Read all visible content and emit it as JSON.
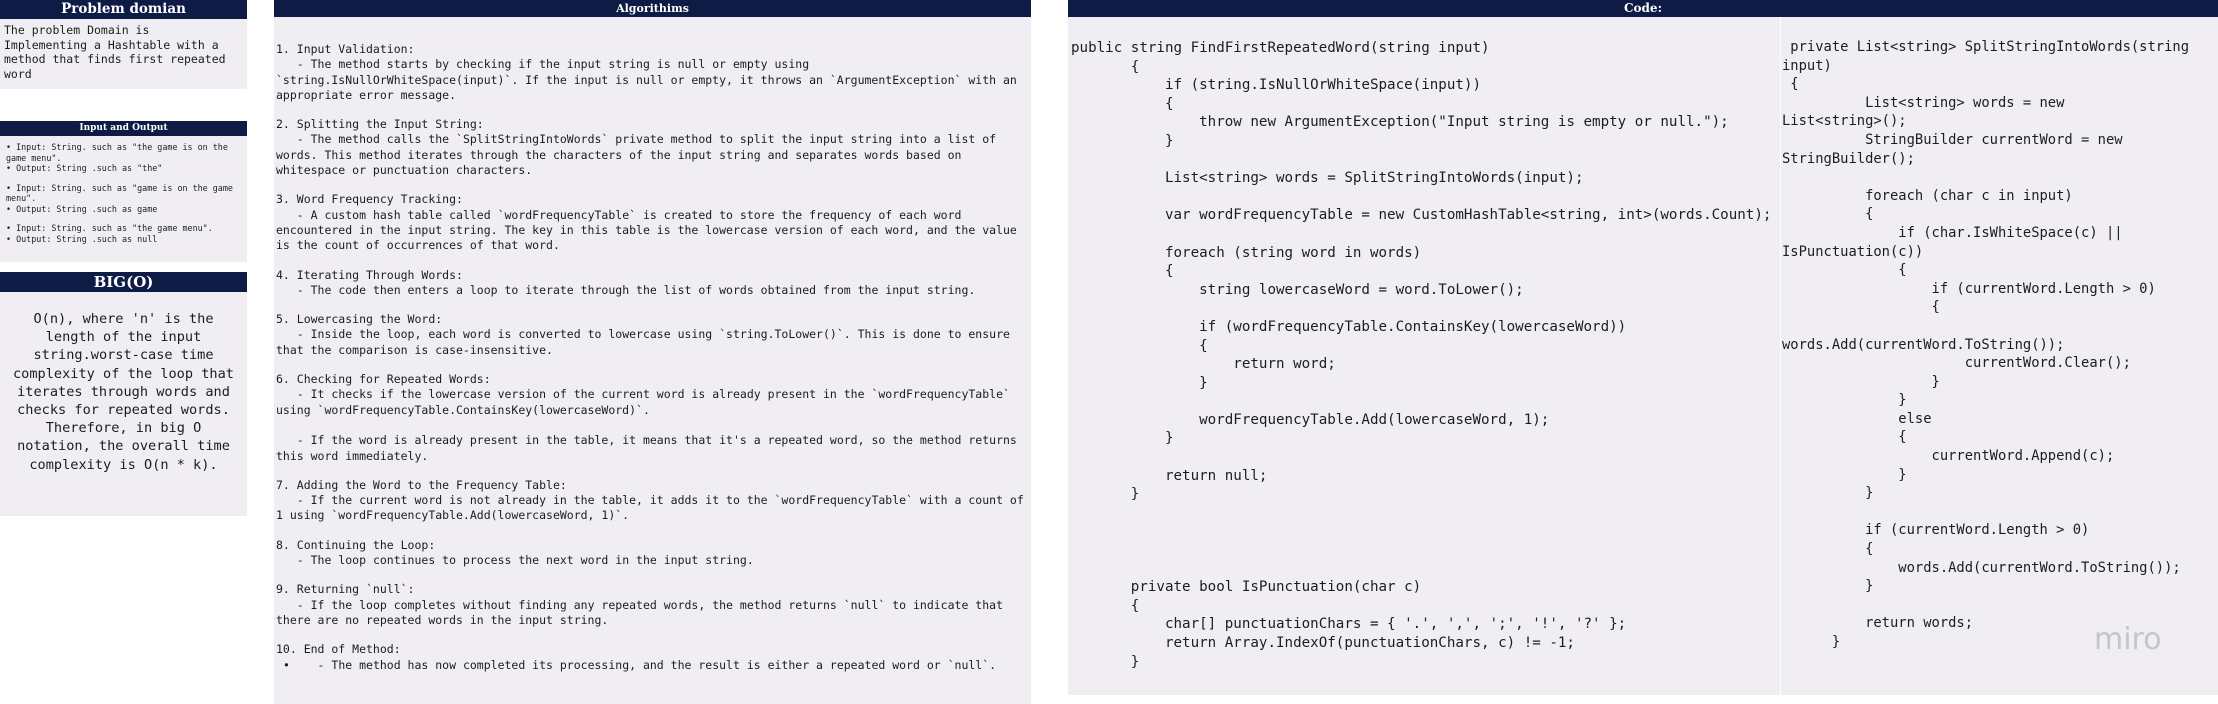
{
  "problem": {
    "header": "Problem domian",
    "text": "The problem Domain is Implementing a Hashtable with a method that finds first repeated word"
  },
  "io": {
    "header": "Input and Output",
    "groups": [
      [
        "Input: String. such as \"the game is on the game menu\".",
        "Output: String .such as \"the\""
      ],
      [
        "Input: String. such as \"game is on the game menu\".",
        "Output: String .such as game"
      ],
      [
        "Input: String. such as \"the game menu\".",
        "Output: String .such as null"
      ]
    ]
  },
  "bigo": {
    "header": "BIG(O)",
    "text": "O(n), where 'n' is the length of the input string.worst-case time complexity of the loop that iterates through words and checks for repeated words. Therefore, in big O notation, the overall time complexity is O(n * k)."
  },
  "algorithms": {
    "header": "Algorithims",
    "items": [
      {
        "title": "1. Input Validation:",
        "body": "   - The method starts by checking if the input string is null or empty using `string.IsNullOrWhiteSpace(input)`. If the input is null or empty, it throws an `ArgumentException` with an appropriate error message."
      },
      {
        "title": "2. Splitting the Input String:",
        "body": "   - The method calls the `SplitStringIntoWords` private method to split the input string into a list of words. This method iterates through the characters of the input string and separates words based on whitespace or punctuation characters."
      },
      {
        "title": "3. Word Frequency Tracking:",
        "body": "   - A custom hash table called `wordFrequencyTable` is created to store the frequency of each word encountered in the input string. The key in this table is the lowercase version of each word, and the value is the count of occurrences of that word."
      },
      {
        "title": "4. Iterating Through Words:",
        "body": "   - The code then enters a loop to iterate through the list of words obtained from the input string."
      },
      {
        "title": "5. Lowercasing the Word:",
        "body": "   - Inside the loop, each word is converted to lowercase using `string.ToLower()`. This is done to ensure that the comparison is case-insensitive."
      },
      {
        "title": "6. Checking for Repeated Words:",
        "body": "   - It checks if the lowercase version of the current word is already present in the `wordFrequencyTable` using `wordFrequencyTable.ContainsKey(lowercaseWord)`.\n\n   - If the word is already present in the table, it means that it's a repeated word, so the method returns this word immediately."
      },
      {
        "title": "7. Adding the Word to the Frequency Table:",
        "body": "   - If the current word is not already in the table, it adds it to the `wordFrequencyTable` with a count of 1 using `wordFrequencyTable.Add(lowercaseWord, 1)`."
      },
      {
        "title": "8. Continuing the Loop:",
        "body": "   - The loop continues to process the next word in the input string."
      },
      {
        "title": "9. Returning `null`:",
        "body": "   - If the loop completes without finding any repeated words, the method returns `null` to indicate that there are no repeated words in the input string."
      },
      {
        "title": "10. End of Method:",
        "body": " •    - The method has now completed its processing, and the result is either a repeated word or `null`."
      }
    ]
  },
  "code": {
    "header": "Code:",
    "left": "public string FindFirstRepeatedWord(string input)\n       {\n           if (string.IsNullOrWhiteSpace(input))\n           {\n               throw new ArgumentException(\"Input string is empty or null.\");\n           }\n\n           List<string> words = SplitStringIntoWords(input);\n\n           var wordFrequencyTable = new CustomHashTable<string, int>(words.Count);\n\n           foreach (string word in words)\n           {\n               string lowercaseWord = word.ToLower();\n\n               if (wordFrequencyTable.ContainsKey(lowercaseWord))\n               {\n                   return word;\n               }\n\n               wordFrequencyTable.Add(lowercaseWord, 1);\n           }\n\n           return null;\n       }\n\n\n\n\n       private bool IsPunctuation(char c)\n       {\n           char[] punctuationChars = { '.', ',', ';', '!', '?' };\n           return Array.IndexOf(punctuationChars, c) != -1;\n       }",
    "right": " private List<string> SplitStringIntoWords(string\ninput)\n {\n          List<string> words = new\nList<string>();\n          StringBuilder currentWord = new\nStringBuilder();\n\n          foreach (char c in input)\n          {\n              if (char.IsWhiteSpace(c) ||\nIsPunctuation(c))\n              {\n                  if (currentWord.Length > 0)\n                  {\n\nwords.Add(currentWord.ToString());\n                      currentWord.Clear();\n                  }\n              }\n              else\n              {\n                  currentWord.Append(c);\n              }\n          }\n\n          if (currentWord.Length > 0)\n          {\n              words.Add(currentWord.ToString());\n          }\n\n          return words;\n      }",
    "watermark": "miro"
  }
}
